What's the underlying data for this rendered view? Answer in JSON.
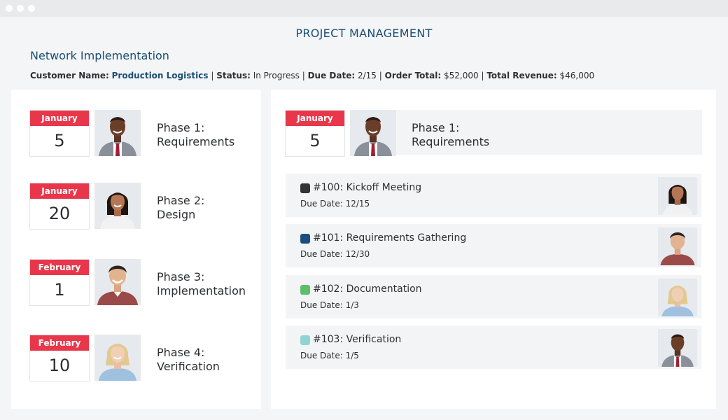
{
  "header": {
    "app_title": "PROJECT MANAGEMENT",
    "project_name": "Network Implementation",
    "summary": {
      "customer_label": "Customer Name:",
      "customer_value": "Production Logistics",
      "status_label": "Status:",
      "status_value": "In Progress",
      "due_label": "Due Date:",
      "due_value": "2/15",
      "order_label": "Order Total:",
      "order_value": "$52,000",
      "revenue_label": "Total Revenue:",
      "revenue_value": "$46,000",
      "separator": "|"
    }
  },
  "phases": [
    {
      "month": "January",
      "day": "5",
      "line1": "Phase 1:",
      "line2": "Requirements",
      "avatar": "man-suit-avatar"
    },
    {
      "month": "January",
      "day": "20",
      "line1": "Phase 2:",
      "line2": "Design",
      "avatar": "woman-dark-hair-avatar"
    },
    {
      "month": "February",
      "day": "1",
      "line1": "Phase 3:",
      "line2": "Implementation",
      "avatar": "man-red-sweater-avatar"
    },
    {
      "month": "February",
      "day": "10",
      "line1": "Phase 4:",
      "line2": "Verification",
      "avatar": "woman-blonde-avatar"
    }
  ],
  "selected_phase": {
    "month": "January",
    "day": "5",
    "line1": "Phase 1:",
    "line2": "Requirements"
  },
  "tasks": [
    {
      "name": "#100: Kickoff Meeting",
      "due": "Due Date: 12/15",
      "color": "#333333"
    },
    {
      "name": "#101: Requirements Gathering",
      "due": "Due Date: 12/30",
      "color": "#1b4e80"
    },
    {
      "name": "#102: Documentation",
      "due": "Due Date: 1/3",
      "color": "#5cbf6a"
    },
    {
      "name": "#103: Verification",
      "due": "Due Date: 1/5",
      "color": "#8fd4d2"
    }
  ],
  "colors": {
    "accent_red": "#e8374b",
    "title_blue": "#1b4e74",
    "panel_bg": "#ffffff",
    "card_bg": "#f3f4f6"
  }
}
